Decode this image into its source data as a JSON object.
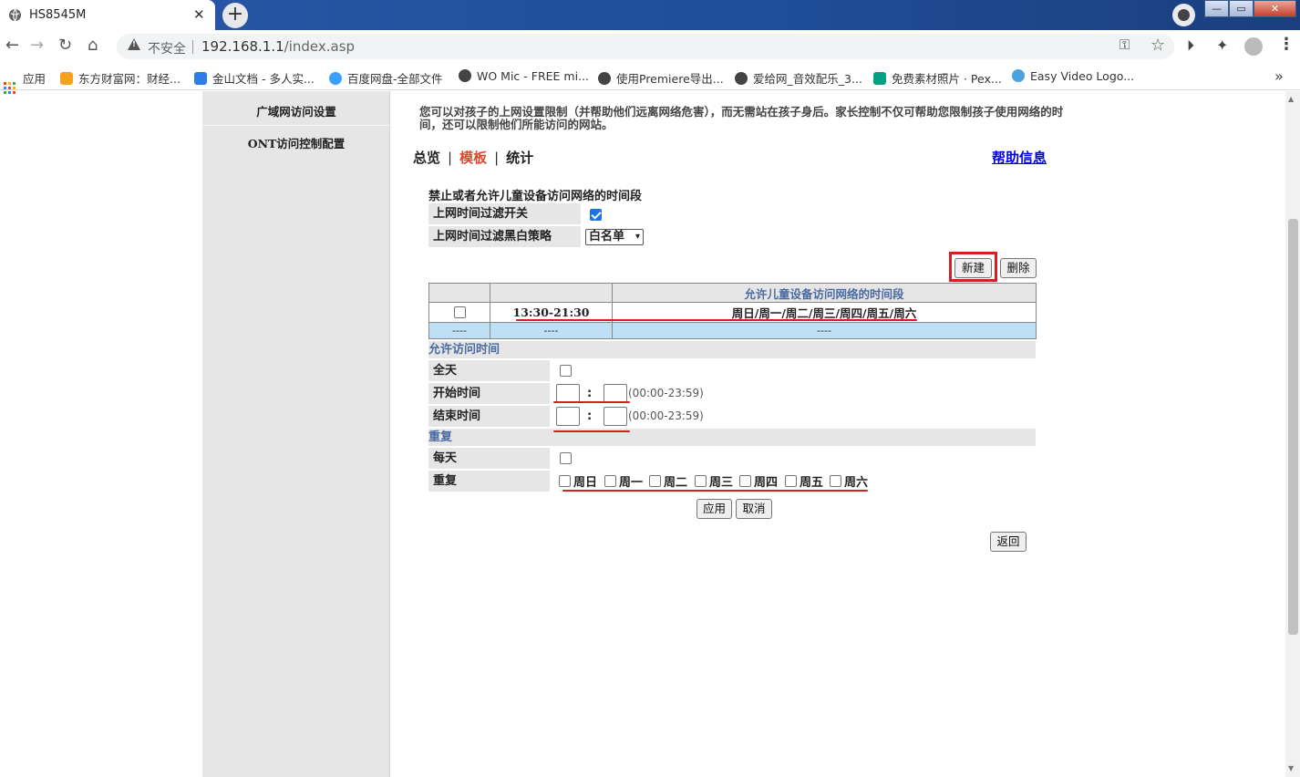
{
  "browser": {
    "tab_title": "HS8545M",
    "close_glyph": "✕",
    "newtab_glyph": "+",
    "insecure_label": "不安全",
    "url_host": "192.168.1.1",
    "url_path": "/index.asp",
    "window_buttons": {
      "min": "—",
      "max": "▭",
      "close": "✕"
    }
  },
  "bookmarks": [
    {
      "label": "应用",
      "color": "#e8453c"
    },
    {
      "label": "东方财富网：财经...",
      "color": "#f4a020"
    },
    {
      "label": "金山文档 - 多人实...",
      "color": "#2f7ee8"
    },
    {
      "label": "百度网盘-全部文件",
      "color": "#3aa0ff"
    },
    {
      "label": "WO Mic - FREE mi...",
      "color": "#444444"
    },
    {
      "label": "使用Premiere导出...",
      "color": "#444444"
    },
    {
      "label": "爱给网_音效配乐_3...",
      "color": "#444444"
    },
    {
      "label": "免费素材照片 · Pex...",
      "color": "#05a081"
    },
    {
      "label": "Easy Video Logo...",
      "color": "#4aa3df"
    }
  ],
  "sidebar": {
    "items": [
      {
        "label": "广域网访问设置"
      },
      {
        "label": "ONT访问控制配置"
      }
    ]
  },
  "intro_text": "您可以对孩子的上网设置限制（并帮助他们远离网络危害），而无需站在孩子身后。家长控制不仅可帮助您限制孩子使用网络的时间，还可以限制他们所能访问的网站。",
  "tabs": {
    "overview": "总览",
    "template": "模板",
    "stats": "统计",
    "divider": "|"
  },
  "help_link": "帮助信息",
  "section_title": "禁止或者允许儿童设备访问网络的时间段",
  "filter_switch": {
    "label": "上网时间过滤开关",
    "checked": true
  },
  "filter_policy": {
    "label": "上网时间过滤黑白策略",
    "selected": "白名单",
    "caret": "▾"
  },
  "buttons": {
    "new": "新建",
    "delete": "删除",
    "apply": "应用",
    "cancel": "取消",
    "back": "返回"
  },
  "table": {
    "header": "允许儿童设备访问网络的时间段",
    "rows": [
      {
        "time": "13:30-21:30",
        "days": "周日/周一/周二/周三/周四/周五/周六"
      }
    ],
    "placeholder_row": [
      "----",
      "----",
      "----"
    ]
  },
  "allow_time": {
    "title": "允许访问时间",
    "all_day": "全天",
    "start_label": "开始时间",
    "end_label": "结束时间",
    "colon": ":",
    "range_hint": "(00:00-23:59)"
  },
  "repeat": {
    "title": "重复",
    "every_day": "每天",
    "repeat_label": "重复",
    "days": [
      "周日",
      "周一",
      "周二",
      "周三",
      "周四",
      "周五",
      "周六"
    ]
  }
}
